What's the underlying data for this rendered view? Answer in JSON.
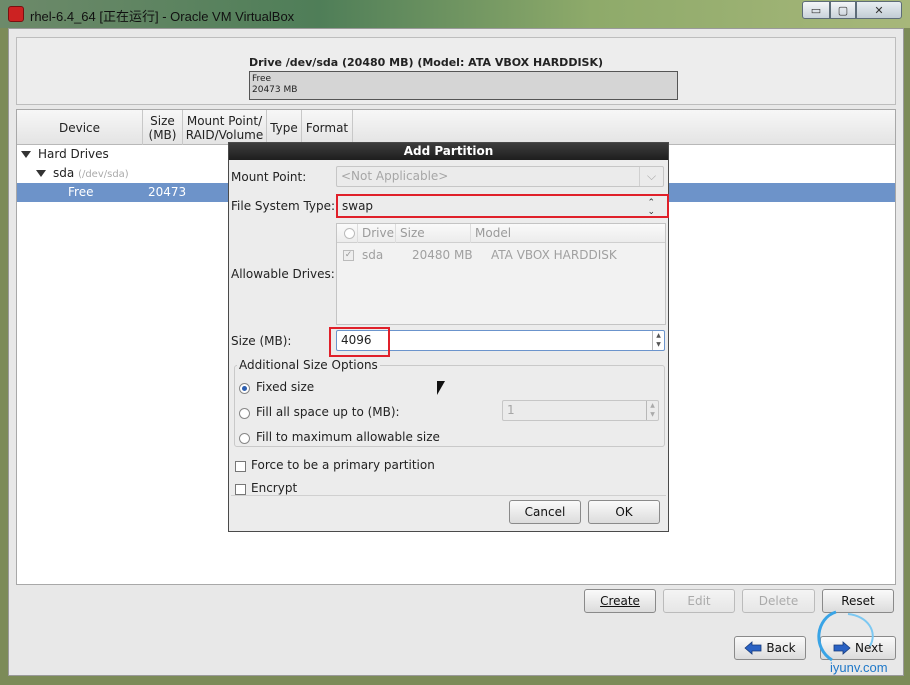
{
  "window": {
    "title": "rhel-6.4_64 [正在运行] - Oracle VM VirtualBox",
    "min": "▭",
    "max": "▢",
    "close": "✕"
  },
  "drive": {
    "label": "Drive /dev/sda (20480 MB) (Model: ATA VBOX HARDDISK)",
    "free_label": "Free",
    "free_size": "20473 MB"
  },
  "table": {
    "headers": [
      "Device",
      "Size\n(MB)",
      "Mount Point/\nRAID/Volume",
      "Type",
      "Format"
    ],
    "hard_drives": "Hard Drives",
    "sda": "sda",
    "sda_path": "(/dev/sda)",
    "free": "Free",
    "free_size": "20473"
  },
  "dialog": {
    "title": "Add Partition",
    "mount_point_label": "Mount Point:",
    "mount_point_value": "<Not Applicable>",
    "fs_type_label": "File System Type:",
    "fs_type_value": "swap",
    "allowable_label": "Allowable Drives:",
    "drive_cols": [
      "Drive",
      "Size",
      "Model"
    ],
    "drive_row": {
      "drive": "sda",
      "size": "20480 MB",
      "model": "ATA VBOX HARDDISK"
    },
    "size_label": "Size (MB):",
    "size_value": "4096",
    "additional": "Additional Size Options",
    "fixed": "Fixed size",
    "fill_upto": "Fill all space up to (MB):",
    "fill_upto_value": "1",
    "fill_max": "Fill to maximum allowable size",
    "primary": "Force to be a primary partition",
    "encrypt": "Encrypt",
    "cancel": "Cancel",
    "ok": "OK"
  },
  "buttons": {
    "create": "Create",
    "edit": "Edit",
    "delete": "Delete",
    "reset": "Reset",
    "back": "Back",
    "next": "Next"
  },
  "watermark": "iyunv.com"
}
